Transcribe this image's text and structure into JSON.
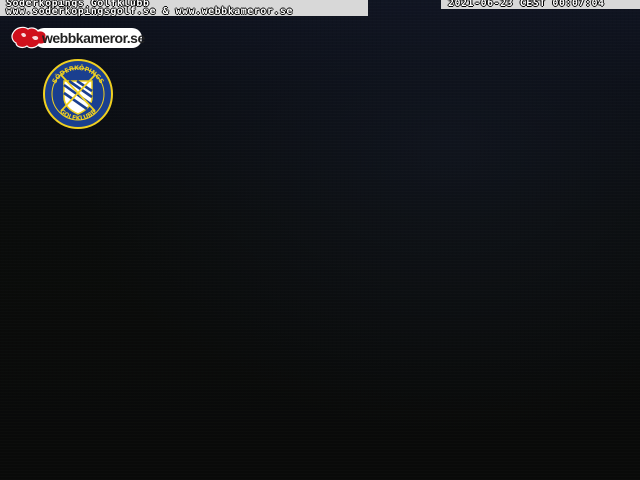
{
  "overlay": {
    "caption_line1": "Söderköpings Golfklubb",
    "caption_line2": "www.soderkopingsgolf.se & www.webbkameror.se",
    "timestamp": "2021-06-23 CEST 00:07:04"
  },
  "logos": {
    "webbkameror_text": "webbkameror.se",
    "club_name_top": "SÖDERKÖPINGS",
    "club_name_bottom": "GOLFKLUBB"
  },
  "colors": {
    "sky": "#0f1320",
    "ground": "#0a0c0b",
    "overlay_band": "#d8d8d8",
    "map_red": "#d0101c",
    "club_blue": "#1a3f8f",
    "club_yellow": "#f0d020"
  }
}
